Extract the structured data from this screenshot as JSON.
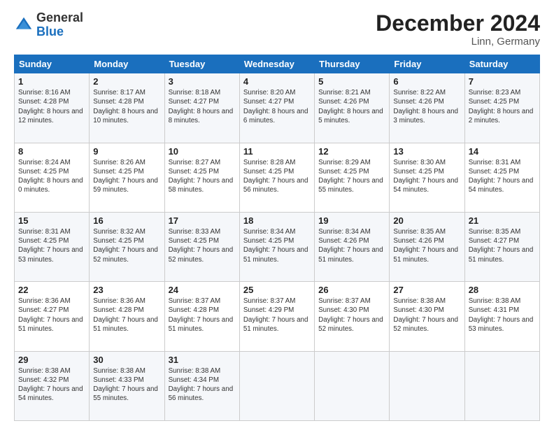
{
  "header": {
    "logo_general": "General",
    "logo_blue": "Blue",
    "month_title": "December 2024",
    "location": "Linn, Germany"
  },
  "weekdays": [
    "Sunday",
    "Monday",
    "Tuesday",
    "Wednesday",
    "Thursday",
    "Friday",
    "Saturday"
  ],
  "weeks": [
    [
      {
        "day": "1",
        "info": "Sunrise: 8:16 AM\nSunset: 4:28 PM\nDaylight: 8 hours and 12 minutes."
      },
      {
        "day": "2",
        "info": "Sunrise: 8:17 AM\nSunset: 4:28 PM\nDaylight: 8 hours and 10 minutes."
      },
      {
        "day": "3",
        "info": "Sunrise: 8:18 AM\nSunset: 4:27 PM\nDaylight: 8 hours and 8 minutes."
      },
      {
        "day": "4",
        "info": "Sunrise: 8:20 AM\nSunset: 4:27 PM\nDaylight: 8 hours and 6 minutes."
      },
      {
        "day": "5",
        "info": "Sunrise: 8:21 AM\nSunset: 4:26 PM\nDaylight: 8 hours and 5 minutes."
      },
      {
        "day": "6",
        "info": "Sunrise: 8:22 AM\nSunset: 4:26 PM\nDaylight: 8 hours and 3 minutes."
      },
      {
        "day": "7",
        "info": "Sunrise: 8:23 AM\nSunset: 4:25 PM\nDaylight: 8 hours and 2 minutes."
      }
    ],
    [
      {
        "day": "8",
        "info": "Sunrise: 8:24 AM\nSunset: 4:25 PM\nDaylight: 8 hours and 0 minutes."
      },
      {
        "day": "9",
        "info": "Sunrise: 8:26 AM\nSunset: 4:25 PM\nDaylight: 7 hours and 59 minutes."
      },
      {
        "day": "10",
        "info": "Sunrise: 8:27 AM\nSunset: 4:25 PM\nDaylight: 7 hours and 58 minutes."
      },
      {
        "day": "11",
        "info": "Sunrise: 8:28 AM\nSunset: 4:25 PM\nDaylight: 7 hours and 56 minutes."
      },
      {
        "day": "12",
        "info": "Sunrise: 8:29 AM\nSunset: 4:25 PM\nDaylight: 7 hours and 55 minutes."
      },
      {
        "day": "13",
        "info": "Sunrise: 8:30 AM\nSunset: 4:25 PM\nDaylight: 7 hours and 54 minutes."
      },
      {
        "day": "14",
        "info": "Sunrise: 8:31 AM\nSunset: 4:25 PM\nDaylight: 7 hours and 54 minutes."
      }
    ],
    [
      {
        "day": "15",
        "info": "Sunrise: 8:31 AM\nSunset: 4:25 PM\nDaylight: 7 hours and 53 minutes."
      },
      {
        "day": "16",
        "info": "Sunrise: 8:32 AM\nSunset: 4:25 PM\nDaylight: 7 hours and 52 minutes."
      },
      {
        "day": "17",
        "info": "Sunrise: 8:33 AM\nSunset: 4:25 PM\nDaylight: 7 hours and 52 minutes."
      },
      {
        "day": "18",
        "info": "Sunrise: 8:34 AM\nSunset: 4:25 PM\nDaylight: 7 hours and 51 minutes."
      },
      {
        "day": "19",
        "info": "Sunrise: 8:34 AM\nSunset: 4:26 PM\nDaylight: 7 hours and 51 minutes."
      },
      {
        "day": "20",
        "info": "Sunrise: 8:35 AM\nSunset: 4:26 PM\nDaylight: 7 hours and 51 minutes."
      },
      {
        "day": "21",
        "info": "Sunrise: 8:35 AM\nSunset: 4:27 PM\nDaylight: 7 hours and 51 minutes."
      }
    ],
    [
      {
        "day": "22",
        "info": "Sunrise: 8:36 AM\nSunset: 4:27 PM\nDaylight: 7 hours and 51 minutes."
      },
      {
        "day": "23",
        "info": "Sunrise: 8:36 AM\nSunset: 4:28 PM\nDaylight: 7 hours and 51 minutes."
      },
      {
        "day": "24",
        "info": "Sunrise: 8:37 AM\nSunset: 4:28 PM\nDaylight: 7 hours and 51 minutes."
      },
      {
        "day": "25",
        "info": "Sunrise: 8:37 AM\nSunset: 4:29 PM\nDaylight: 7 hours and 51 minutes."
      },
      {
        "day": "26",
        "info": "Sunrise: 8:37 AM\nSunset: 4:30 PM\nDaylight: 7 hours and 52 minutes."
      },
      {
        "day": "27",
        "info": "Sunrise: 8:38 AM\nSunset: 4:30 PM\nDaylight: 7 hours and 52 minutes."
      },
      {
        "day": "28",
        "info": "Sunrise: 8:38 AM\nSunset: 4:31 PM\nDaylight: 7 hours and 53 minutes."
      }
    ],
    [
      {
        "day": "29",
        "info": "Sunrise: 8:38 AM\nSunset: 4:32 PM\nDaylight: 7 hours and 54 minutes."
      },
      {
        "day": "30",
        "info": "Sunrise: 8:38 AM\nSunset: 4:33 PM\nDaylight: 7 hours and 55 minutes."
      },
      {
        "day": "31",
        "info": "Sunrise: 8:38 AM\nSunset: 4:34 PM\nDaylight: 7 hours and 56 minutes."
      },
      {
        "day": "",
        "info": ""
      },
      {
        "day": "",
        "info": ""
      },
      {
        "day": "",
        "info": ""
      },
      {
        "day": "",
        "info": ""
      }
    ]
  ]
}
